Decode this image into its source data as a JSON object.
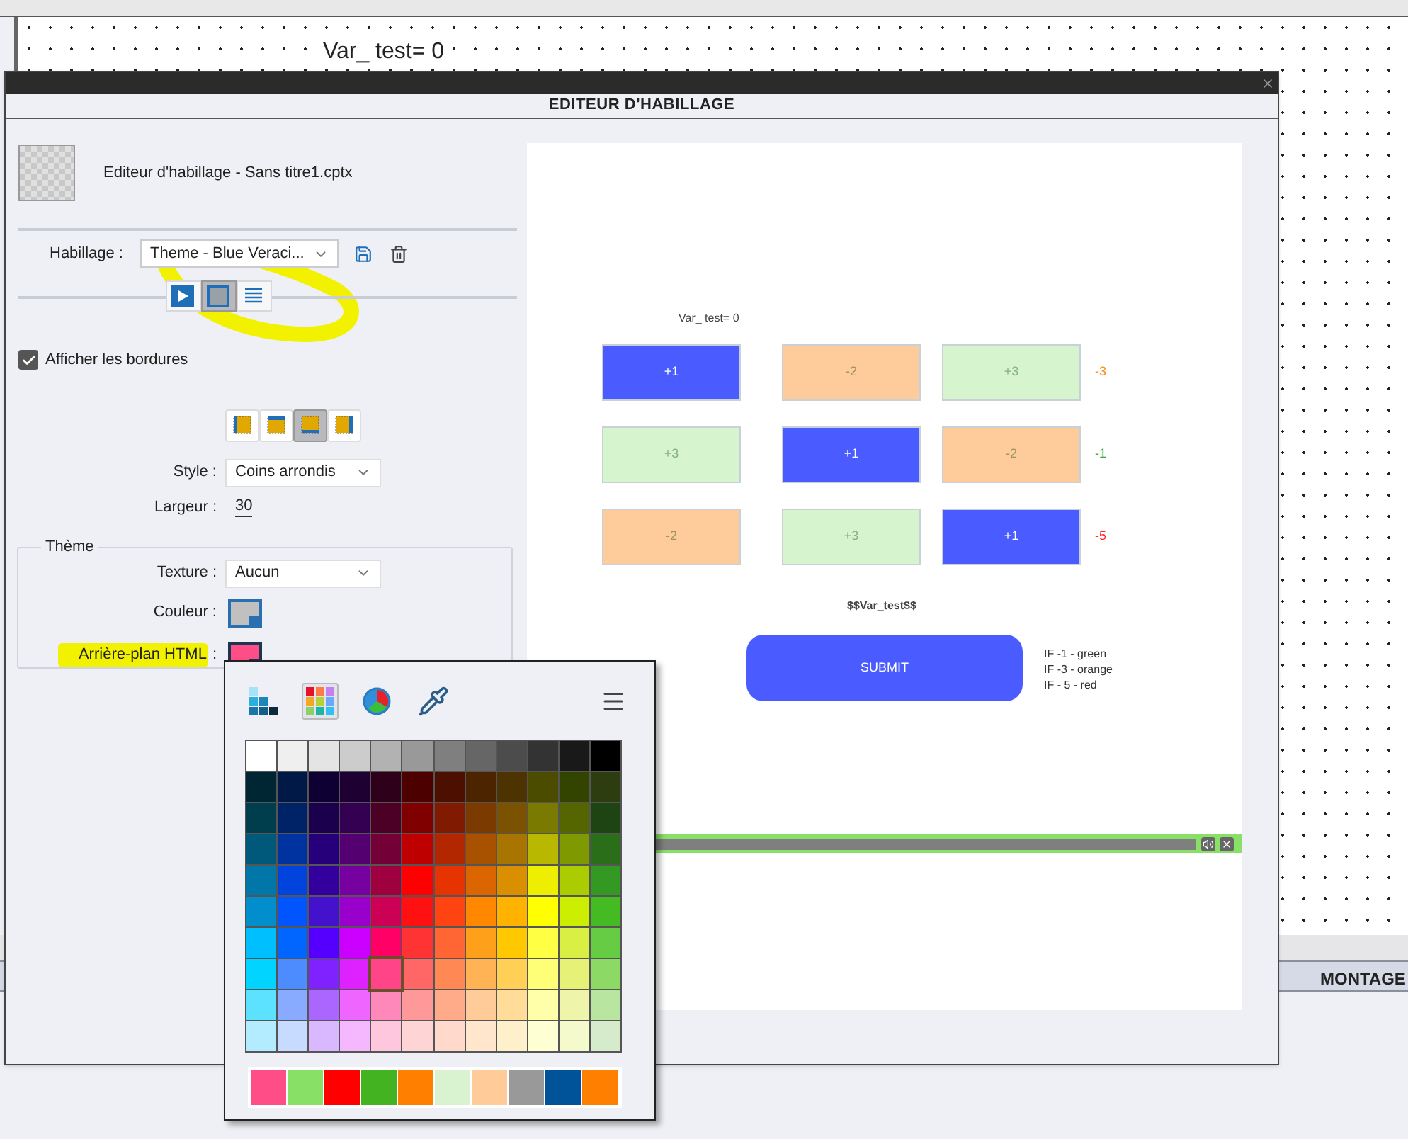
{
  "canvas": {
    "variable_text": "Var_ test= 0"
  },
  "dialog": {
    "title": "EDITEUR D'HABILLAGE",
    "file_label": "Editeur d'habillage - Sans titre1.cptx",
    "skin": {
      "label": "Habillage :",
      "value": "Theme - Blue Veraci..."
    },
    "view_tabs": [
      {
        "kind": "playbar",
        "selected": false
      },
      {
        "kind": "borders",
        "selected": true
      },
      {
        "kind": "toc",
        "selected": false
      }
    ],
    "show_borders": {
      "label": "Afficher les bordures",
      "checked": true
    },
    "border_sides": [
      {
        "kind": "left",
        "selected": false
      },
      {
        "kind": "top",
        "selected": false
      },
      {
        "kind": "bottom",
        "selected": true
      },
      {
        "kind": "right",
        "selected": false
      }
    ],
    "style": {
      "label": "Style :",
      "value": "Coins arrondis"
    },
    "width": {
      "label": "Largeur :",
      "value": "30"
    },
    "theme": {
      "legend": "Thème",
      "texture": {
        "label": "Texture :",
        "value": "Aucun"
      },
      "color": {
        "label": "Couleur :",
        "color": "#c0c0c0"
      },
      "html_background": {
        "label": "Arrière-plan HTML",
        "separator": ":",
        "color": "#ff4d88"
      }
    },
    "preview": {
      "variable_text": "Var_ test= 0",
      "rows": [
        {
          "tiles": [
            {
              "label": "+1",
              "color": "#4a5cff"
            },
            {
              "label": "-2",
              "color": "#fdcc9a"
            },
            {
              "label": "+3",
              "color": "#d6f5cf"
            }
          ],
          "result": {
            "text": "-3",
            "color": "#ff8c1a"
          }
        },
        {
          "tiles": [
            {
              "label": "+3",
              "color": "#d6f5cf"
            },
            {
              "label": "+1",
              "color": "#4a5cff"
            },
            {
              "label": "-2",
              "color": "#fdcc9a"
            }
          ],
          "result": {
            "text": "-1",
            "color": "#33aa33"
          }
        },
        {
          "tiles": [
            {
              "label": "-2",
              "color": "#fdcc9a"
            },
            {
              "label": "+3",
              "color": "#d6f5cf"
            },
            {
              "label": "+1",
              "color": "#4a5cff"
            }
          ],
          "result": {
            "text": "-5",
            "color": "#ff2222"
          }
        }
      ],
      "result_variable": "$$Var_test$$",
      "submit": "SUBMIT",
      "rules": [
        "IF -1 - green",
        "IF -3 - orange",
        "IF - 5 - red"
      ]
    }
  },
  "color_picker": {
    "modes": [
      {
        "kind": "swatches",
        "selected": false
      },
      {
        "kind": "palette",
        "selected": true
      },
      {
        "kind": "wheel",
        "selected": false
      },
      {
        "kind": "eyedropper",
        "selected": false
      }
    ],
    "palette": [
      [
        {
          "color": "#ffffff",
          "selected": false
        },
        {
          "color": "#efefef",
          "selected": false
        },
        {
          "color": "#e4e4e4",
          "selected": false
        },
        {
          "color": "#cccccc",
          "selected": false
        },
        {
          "color": "#b2b2b2",
          "selected": false
        },
        {
          "color": "#999999",
          "selected": false
        },
        {
          "color": "#7f7f7f",
          "selected": false
        },
        {
          "color": "#666666",
          "selected": false
        },
        {
          "color": "#4c4c4c",
          "selected": false
        },
        {
          "color": "#333333",
          "selected": false
        },
        {
          "color": "#191919",
          "selected": false
        },
        {
          "color": "#000000",
          "selected": false
        }
      ],
      [
        {
          "color": "#002633",
          "selected": false
        },
        {
          "color": "#001947",
          "selected": false
        },
        {
          "color": "#0f0033",
          "selected": false
        },
        {
          "color": "#1f0033",
          "selected": false
        },
        {
          "color": "#2e0019",
          "selected": false
        },
        {
          "color": "#4c0000",
          "selected": false
        },
        {
          "color": "#4c0f00",
          "selected": false
        },
        {
          "color": "#4c2400",
          "selected": false
        },
        {
          "color": "#4c3300",
          "selected": false
        },
        {
          "color": "#4c4c00",
          "selected": false
        },
        {
          "color": "#334400",
          "selected": false
        },
        {
          "color": "#2e3d0f",
          "selected": false
        }
      ],
      [
        {
          "color": "#003d4d",
          "selected": false
        },
        {
          "color": "#002266",
          "selected": false
        },
        {
          "color": "#1a004d",
          "selected": false
        },
        {
          "color": "#330052",
          "selected": false
        },
        {
          "color": "#4d0026",
          "selected": false
        },
        {
          "color": "#800000",
          "selected": false
        },
        {
          "color": "#801a00",
          "selected": false
        },
        {
          "color": "#7a3a00",
          "selected": false
        },
        {
          "color": "#7a5200",
          "selected": false
        },
        {
          "color": "#7a7a00",
          "selected": false
        },
        {
          "color": "#556600",
          "selected": false
        },
        {
          "color": "#1f4414",
          "selected": false
        }
      ],
      [
        {
          "color": "#00587a",
          "selected": false
        },
        {
          "color": "#0033a0",
          "selected": false
        },
        {
          "color": "#26007a",
          "selected": false
        },
        {
          "color": "#550070",
          "selected": false
        },
        {
          "color": "#730036",
          "selected": false
        },
        {
          "color": "#bf0000",
          "selected": false
        },
        {
          "color": "#b22600",
          "selected": false
        },
        {
          "color": "#a85200",
          "selected": false
        },
        {
          "color": "#a87500",
          "selected": false
        },
        {
          "color": "#b8b800",
          "selected": false
        },
        {
          "color": "#7f9900",
          "selected": false
        },
        {
          "color": "#2a6e1a",
          "selected": false
        }
      ],
      [
        {
          "color": "#0077a8",
          "selected": false
        },
        {
          "color": "#0044dd",
          "selected": false
        },
        {
          "color": "#33009e",
          "selected": false
        },
        {
          "color": "#7700a0",
          "selected": false
        },
        {
          "color": "#9e0040",
          "selected": false
        },
        {
          "color": "#ff0000",
          "selected": false
        },
        {
          "color": "#e63300",
          "selected": false
        },
        {
          "color": "#db6600",
          "selected": false
        },
        {
          "color": "#d98f00",
          "selected": false
        },
        {
          "color": "#eeee00",
          "selected": false
        },
        {
          "color": "#aacc00",
          "selected": false
        },
        {
          "color": "#339922",
          "selected": false
        }
      ],
      [
        {
          "color": "#008fcc",
          "selected": false
        },
        {
          "color": "#0055ff",
          "selected": false
        },
        {
          "color": "#4411cc",
          "selected": false
        },
        {
          "color": "#9900cc",
          "selected": false
        },
        {
          "color": "#cc0055",
          "selected": false
        },
        {
          "color": "#ff1111",
          "selected": false
        },
        {
          "color": "#ff4411",
          "selected": false
        },
        {
          "color": "#ff8800",
          "selected": false
        },
        {
          "color": "#ffb300",
          "selected": false
        },
        {
          "color": "#ffff00",
          "selected": false
        },
        {
          "color": "#ccee00",
          "selected": false
        },
        {
          "color": "#44bb22",
          "selected": false
        }
      ],
      [
        {
          "color": "#00bfff",
          "selected": false
        },
        {
          "color": "#0066ff",
          "selected": false
        },
        {
          "color": "#5500ff",
          "selected": false
        },
        {
          "color": "#cc00ff",
          "selected": false
        },
        {
          "color": "#ff0066",
          "selected": false
        },
        {
          "color": "#ff3333",
          "selected": false
        },
        {
          "color": "#ff6633",
          "selected": false
        },
        {
          "color": "#ffa01a",
          "selected": false
        },
        {
          "color": "#ffc800",
          "selected": false
        },
        {
          "color": "#ffff44",
          "selected": false
        },
        {
          "color": "#d9ef44",
          "selected": false
        },
        {
          "color": "#66cc44",
          "selected": false
        }
      ],
      [
        {
          "color": "#00d4ff",
          "selected": false
        },
        {
          "color": "#4d8cff",
          "selected": false
        },
        {
          "color": "#7f22ff",
          "selected": false
        },
        {
          "color": "#dd22ff",
          "selected": false
        },
        {
          "color": "#ff4488",
          "selected": true
        },
        {
          "color": "#ff6666",
          "selected": false
        },
        {
          "color": "#ff8855",
          "selected": false
        },
        {
          "color": "#ffb355",
          "selected": false
        },
        {
          "color": "#ffd055",
          "selected": false
        },
        {
          "color": "#ffff77",
          "selected": false
        },
        {
          "color": "#e6f277",
          "selected": false
        },
        {
          "color": "#8cd966",
          "selected": false
        }
      ],
      [
        {
          "color": "#5ce1ff",
          "selected": false
        },
        {
          "color": "#88aaff",
          "selected": false
        },
        {
          "color": "#aa66ff",
          "selected": false
        },
        {
          "color": "#ee66ff",
          "selected": false
        },
        {
          "color": "#ff88bb",
          "selected": false
        },
        {
          "color": "#ff9999",
          "selected": false
        },
        {
          "color": "#ffaa88",
          "selected": false
        },
        {
          "color": "#ffcc99",
          "selected": false
        },
        {
          "color": "#ffdd99",
          "selected": false
        },
        {
          "color": "#ffffaa",
          "selected": false
        },
        {
          "color": "#eef5aa",
          "selected": false
        },
        {
          "color": "#b8e6a0",
          "selected": false
        }
      ],
      [
        {
          "color": "#b3ecff",
          "selected": false
        },
        {
          "color": "#c7daff",
          "selected": false
        },
        {
          "color": "#dab8ff",
          "selected": false
        },
        {
          "color": "#f5b8ff",
          "selected": false
        },
        {
          "color": "#ffc7de",
          "selected": false
        },
        {
          "color": "#ffd4d4",
          "selected": false
        },
        {
          "color": "#ffd9cc",
          "selected": false
        },
        {
          "color": "#ffe6cc",
          "selected": false
        },
        {
          "color": "#fff0cc",
          "selected": false
        },
        {
          "color": "#ffffd4",
          "selected": false
        },
        {
          "color": "#f5facc",
          "selected": false
        },
        {
          "color": "#d6ebcc",
          "selected": false
        }
      ]
    ],
    "recent": [
      {
        "color": "#ff4d88"
      },
      {
        "color": "#88e066"
      },
      {
        "color": "#ff0000"
      },
      {
        "color": "#44b322"
      },
      {
        "color": "#ff8000"
      },
      {
        "color": "#d9f2cf"
      },
      {
        "color": "#ffcc99"
      },
      {
        "color": "#999999"
      },
      {
        "color": "#005299"
      },
      {
        "color": "#ff8000"
      }
    ]
  },
  "bottom_tab": {
    "label": "MONTAGE"
  }
}
